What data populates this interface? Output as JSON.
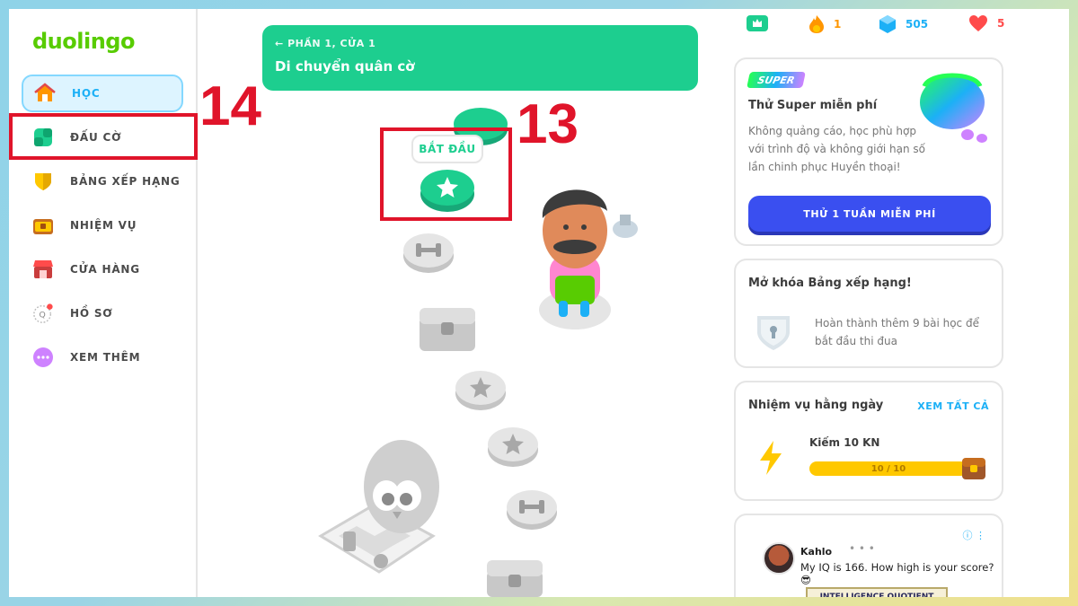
{
  "brand": {
    "name": "duolingo"
  },
  "sidebar": {
    "items": [
      {
        "label": "HỌC",
        "icon": "home-icon",
        "active": true
      },
      {
        "label": "ĐẤU CỜ",
        "icon": "chess-board-icon"
      },
      {
        "label": "BẢNG XẾP HẠNG",
        "icon": "shield-icon"
      },
      {
        "label": "NHIỆM VỤ",
        "icon": "treasure-chest-icon"
      },
      {
        "label": "CỬA HÀNG",
        "icon": "shop-icon"
      },
      {
        "label": "HỒ SƠ",
        "icon": "profile-icon"
      },
      {
        "label": "XEM THÊM",
        "icon": "more-icon"
      }
    ]
  },
  "annotations": {
    "first": "14",
    "second": "13"
  },
  "unit": {
    "back_label": "PHẦN 1, CỬA 1",
    "title": "Di chuyển quân cờ"
  },
  "path": {
    "start_label": "BẮT ĐẦU"
  },
  "stats": {
    "streak": "1",
    "gems": "505",
    "hearts": "5"
  },
  "super_card": {
    "badge": "SUPER",
    "title": "Thử Super miễn phí",
    "body": "Không quảng cáo, học phù hợp với trình độ và không giới hạn số lần chinh phục Huyền thoại!",
    "button": "THỬ 1 TUẦN MIỄN PHÍ"
  },
  "leaderboard_card": {
    "title": "Mở khóa Bảng xếp hạng!",
    "body": "Hoàn thành thêm 9 bài học để bắt đầu thi đua"
  },
  "quests_card": {
    "title": "Nhiệm vụ hằng ngày",
    "link": "XEM TẤT CẢ",
    "quest_title": "Kiếm 10 KN",
    "progress_text": "10 / 10",
    "progress": 1.0
  },
  "ad_card": {
    "author": "Kahlo",
    "message": "My IQ is 166. How high is your score?😎",
    "image_text": "INTELLIGENCE QUOTIENT"
  },
  "colors": {
    "accent_green": "#1dce8f",
    "brand_green": "#58cc02",
    "annotation_red": "#e0142a",
    "button_blue": "#3a4ff0",
    "link_blue": "#1cb0f6"
  }
}
